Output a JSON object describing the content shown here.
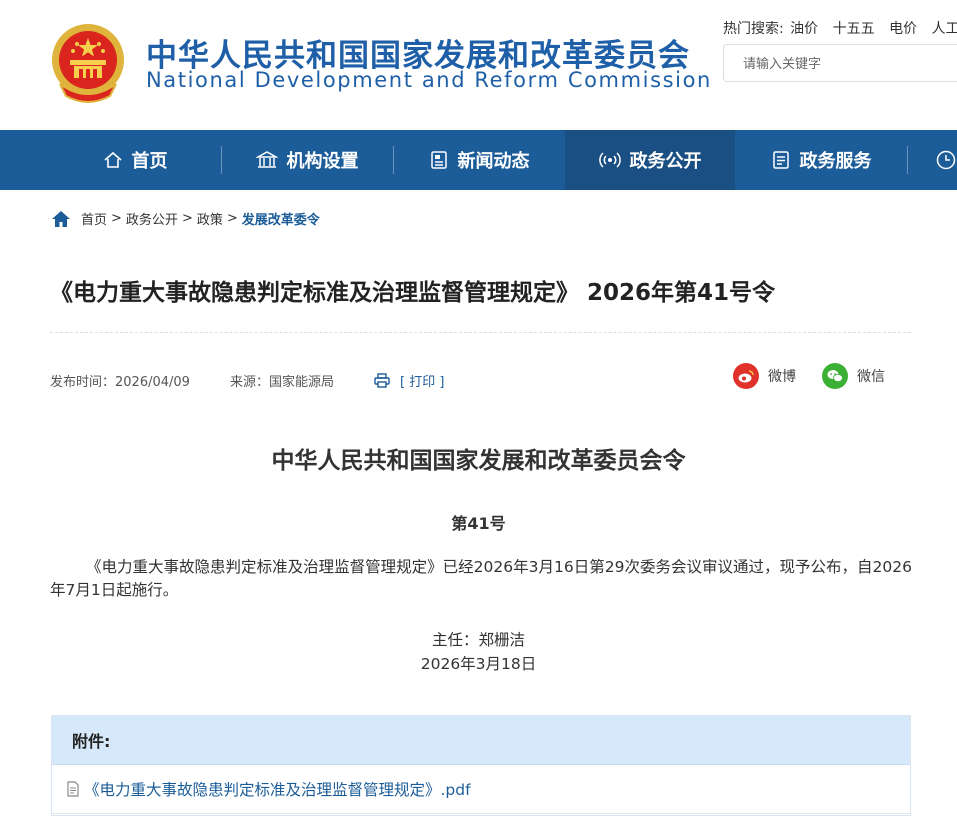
{
  "header": {
    "title_cn": "中华人民共和国国家发展和改革委员会",
    "title_en": "National Development and Reform Commission",
    "hot_search_label": "热门搜索:",
    "hot_search_terms": [
      "油价",
      "十五五",
      "电价",
      "人工智"
    ],
    "search_placeholder": "请输入关键字",
    "emblem_icon": "national-emblem-icon"
  },
  "nav": {
    "items": [
      {
        "label": "首页",
        "icon": "home-icon"
      },
      {
        "label": "机构设置",
        "icon": "building-icon"
      },
      {
        "label": "新闻动态",
        "icon": "news-icon"
      },
      {
        "label": "政务公开",
        "icon": "broadcast-icon",
        "active": true
      },
      {
        "label": "政务服务",
        "icon": "document-icon"
      }
    ],
    "colors": {
      "bar": "#1c5d99",
      "active": "#1a4f83"
    }
  },
  "breadcrumb": {
    "items": [
      "首页",
      "政务公开",
      "政策"
    ],
    "separator": ">",
    "current": "发展改革委令"
  },
  "article": {
    "title": "《电力重大事故隐患判定标准及治理监督管理规定》 2026年第41号令",
    "publish_label": "发布时间：",
    "publish_date": "2026/04/09",
    "source_label": "来源：",
    "source": "国家能源局",
    "print_label": "[ 打印 ]",
    "share_weibo": "微博",
    "share_wechat": "微信"
  },
  "document": {
    "heading": "中华人民共和国国家发展和改革委员会令",
    "number": "第41号",
    "paragraph": "《电力重大事故隐患判定标准及治理监督管理规定》已经2026年3月16日第29次委务会议审议通过，现予公布，自2026年7月1日起施行。",
    "signer": "主任：郑栅洁",
    "date": "2026年3月18日"
  },
  "attachments": {
    "label": "附件:",
    "files": [
      "《电力重大事故隐患判定标准及治理监督管理规定》.pdf"
    ]
  }
}
